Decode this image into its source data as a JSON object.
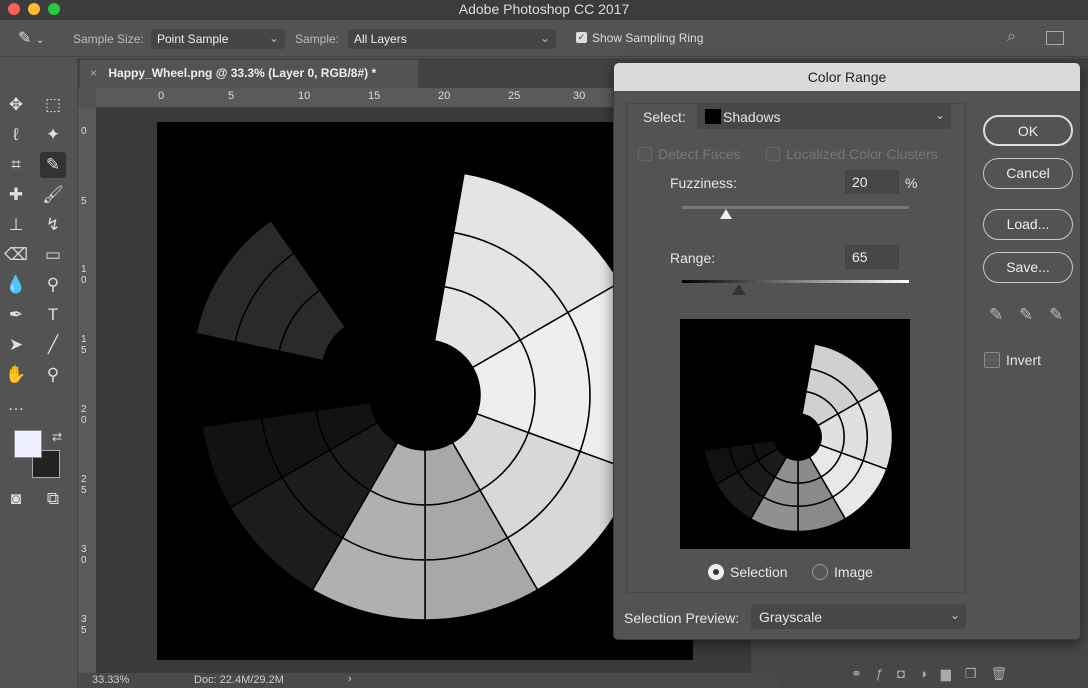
{
  "app": {
    "title": "Adobe Photoshop CC 2017"
  },
  "options": {
    "sample_size_label": "Sample Size:",
    "sample_size_value": "Point Sample",
    "sample_label": "Sample:",
    "sample_value": "All Layers",
    "show_ring_label": "Show Sampling Ring",
    "show_ring_checked": true
  },
  "document": {
    "tab_title": "Happy_Wheel.png @ 33.3% (Layer 0, RGB/8#) *",
    "close": "×",
    "ruler_top": [
      "0",
      "5",
      "10",
      "15",
      "20",
      "25",
      "30"
    ],
    "ruler_left": [
      "0",
      "5",
      "1\n0",
      "1\n5",
      "2\n0",
      "2\n5",
      "3\n0",
      "3\n5"
    ]
  },
  "status": {
    "zoom": "33.33%",
    "doc": "Doc: 22.4M/29.2M",
    "arrow": "›"
  },
  "dialog": {
    "title": "Color Range",
    "select_label": "Select:",
    "select_value": "Shadows",
    "detect_faces": "Detect Faces",
    "localized": "Localized Color Clusters",
    "fuzziness_label": "Fuzziness:",
    "fuzziness_value": "20",
    "fuzziness_unit": "%",
    "range_label": "Range:",
    "range_value": "65",
    "radio_selection": "Selection",
    "radio_image": "Image",
    "radio_selected": "Selection",
    "preview_label": "Selection Preview:",
    "preview_value": "Grayscale",
    "ok": "OK",
    "cancel": "Cancel",
    "load": "Load...",
    "save": "Save...",
    "invert": "Invert",
    "invert_checked": false
  }
}
